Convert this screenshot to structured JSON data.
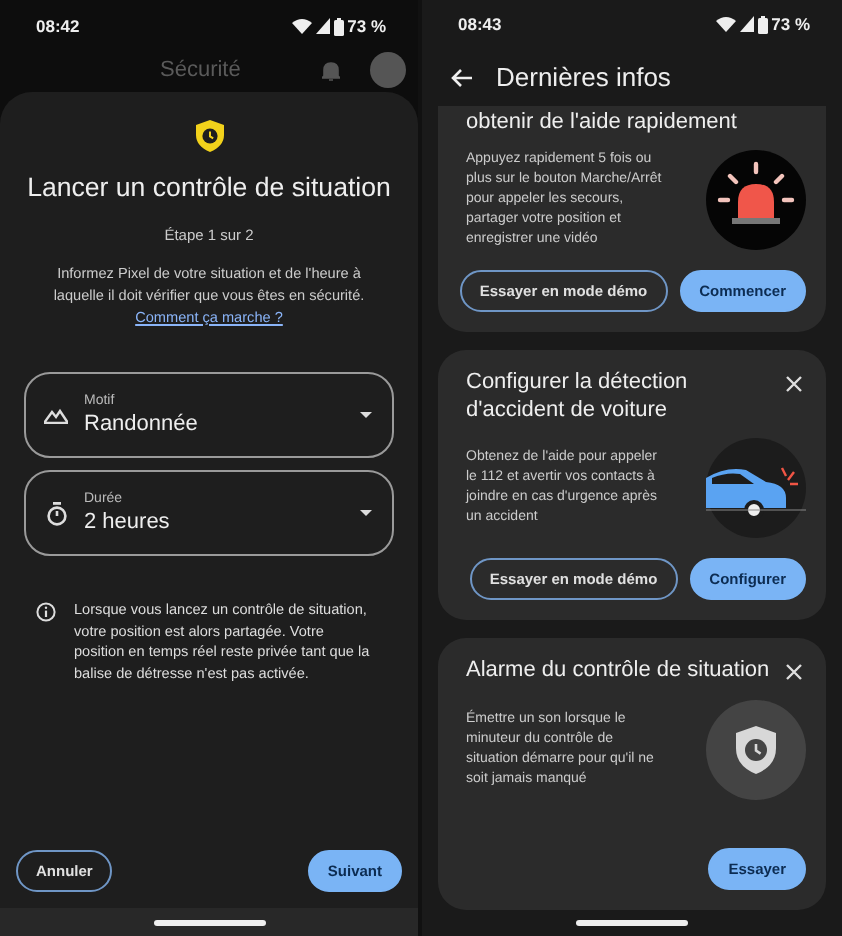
{
  "left_screen": {
    "status_bar": {
      "time": "08:42",
      "battery": "73 %"
    },
    "background_header": {
      "title": "Sécurité"
    },
    "sheet": {
      "title": "Lancer un contrôle de situation",
      "step": "Étape 1 sur 2",
      "intro": "Informez Pixel de votre situation et de l'heure à laquelle il doit vérifier que vous êtes en sécurité.",
      "link": "Comment ça marche ?",
      "fields": [
        {
          "label": "Motif",
          "value": "Randonnée",
          "kind": "mountain"
        },
        {
          "label": "Durée",
          "value": "2 heures",
          "kind": "timer"
        }
      ],
      "notice": "Lorsque vous lancez un contrôle de situation, votre position est alors partagée. Votre position en temps réel reste privée tant que la balise de détresse n'est pas activée.",
      "buttons": [
        {
          "label": "Annuler",
          "kind": "outlined"
        },
        {
          "label": "Suivant",
          "kind": "filled"
        }
      ]
    }
  },
  "right_screen": {
    "status_bar": {
      "time": "08:43",
      "battery": "73 %"
    },
    "title": "Dernières infos",
    "cards": [
      {
        "title": "obtenir de l'aide rapidement",
        "text": "Appuyez rapidement 5 fois ou plus sur le bouton Marche/Arrêt pour appeler les secours, partager votre position et enregistrer une vidéo",
        "kind": "siren",
        "dismissible": false,
        "buttons": [
          {
            "label": "Essayer en mode démo",
            "kind": "outlined"
          },
          {
            "label": "Commencer",
            "kind": "filled"
          }
        ]
      },
      {
        "title": "Configurer la détection d'accident de voiture",
        "text": "Obtenez de l'aide pour appeler le 112 et avertir vos contacts à joindre en cas d'urgence après un accident",
        "kind": "car",
        "dismissible": true,
        "buttons": [
          {
            "label": "Essayer en mode démo",
            "kind": "outlined"
          },
          {
            "label": "Configurer",
            "kind": "filled"
          }
        ]
      },
      {
        "title": "Alarme du contrôle de situation",
        "text": "Émettre un son lorsque le minuteur du contrôle de situation démarre pour qu'il ne soit jamais manqué",
        "kind": "shield",
        "dismissible": true,
        "buttons": [
          {
            "label": "Essayer",
            "kind": "filled"
          }
        ]
      }
    ]
  }
}
